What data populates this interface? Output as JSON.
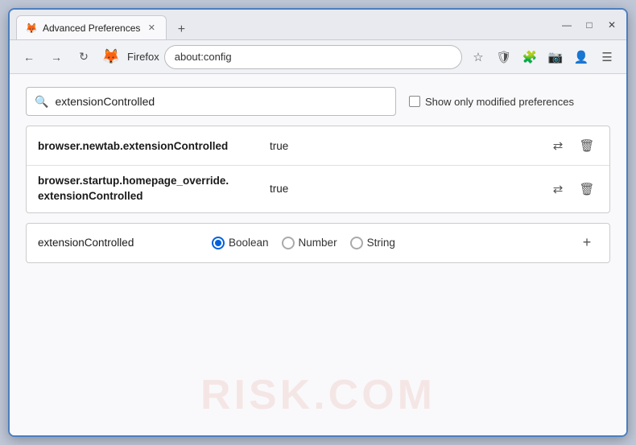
{
  "window": {
    "title": "Advanced Preferences",
    "new_tab_icon": "+",
    "close_icon": "✕",
    "minimize_icon": "—",
    "maximize_icon": "□"
  },
  "tab": {
    "label": "Advanced Preferences",
    "favicon": "🦊"
  },
  "navbar": {
    "back_icon": "←",
    "forward_icon": "→",
    "reload_icon": "↻",
    "firefox_logo": "🦊",
    "browser_name": "Firefox",
    "url": "about:config",
    "bookmark_icon": "☆",
    "shield_icon": "🛡",
    "extension_icon": "🧩",
    "camera_icon": "📷",
    "profile_icon": "👤",
    "menu_icon": "☰"
  },
  "search": {
    "value": "extensionControlled",
    "placeholder": "extensionControlled",
    "show_modified_label": "Show only modified preferences"
  },
  "results": [
    {
      "name": "browser.newtab.extensionControlled",
      "value": "true"
    },
    {
      "name_line1": "browser.startup.homepage_override.",
      "name_line2": "extensionControlled",
      "value": "true"
    }
  ],
  "add_pref": {
    "name": "extensionControlled",
    "types": [
      {
        "label": "Boolean",
        "selected": true
      },
      {
        "label": "Number",
        "selected": false
      },
      {
        "label": "String",
        "selected": false
      }
    ],
    "add_icon": "+"
  },
  "watermark": "RISK.COM",
  "icons": {
    "search": "🔍",
    "toggle": "⇄",
    "delete": "🗑",
    "add": "+"
  }
}
